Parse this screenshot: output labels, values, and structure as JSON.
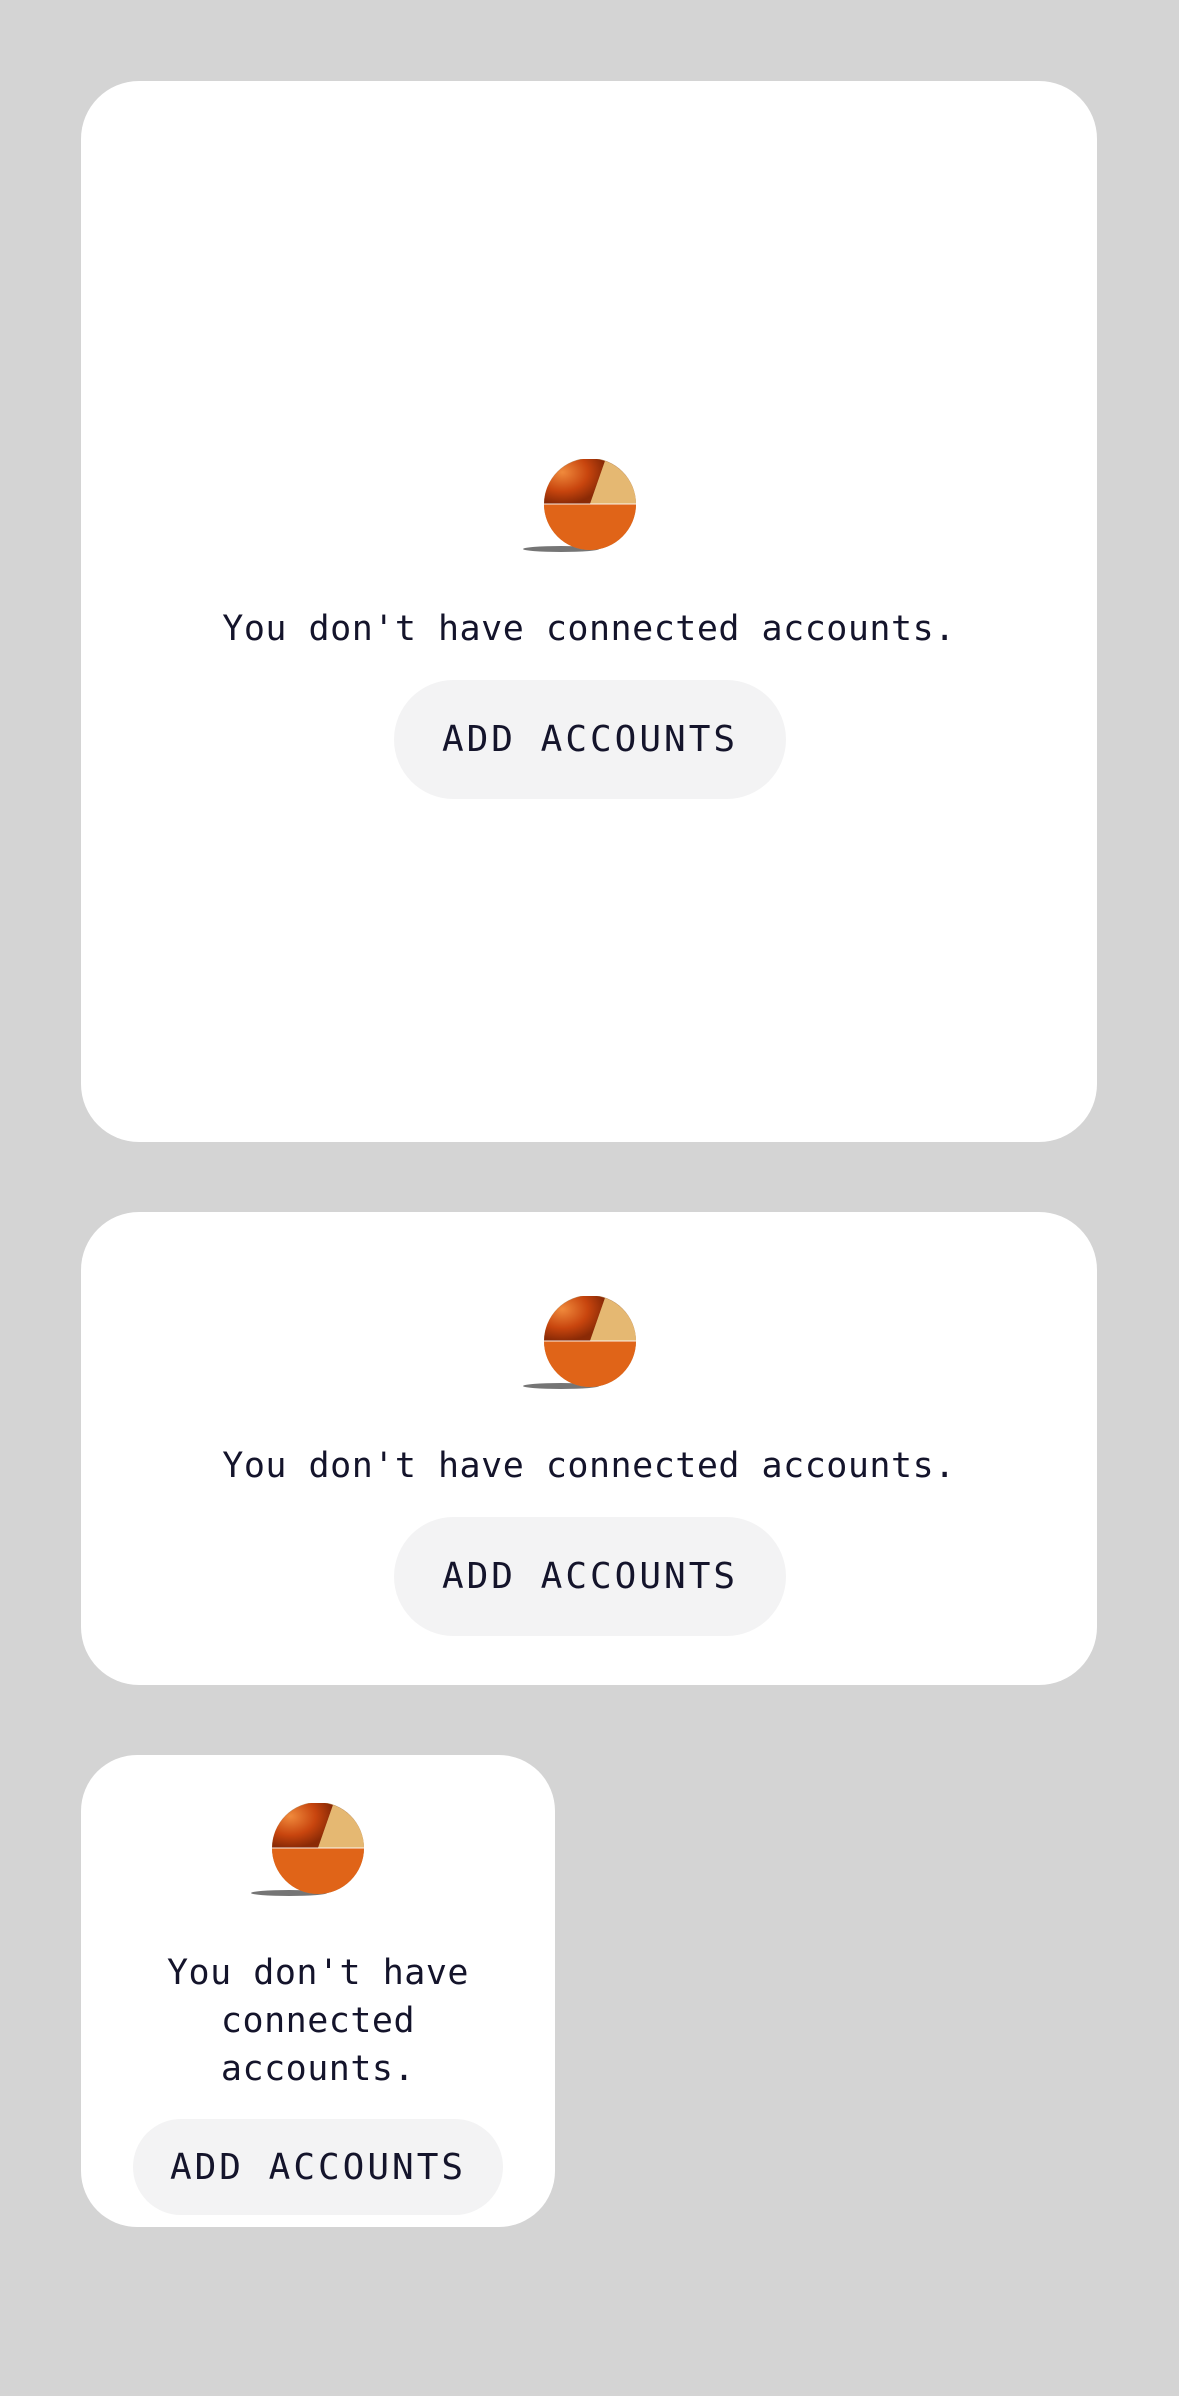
{
  "colors": {
    "background": "#d4d4d4",
    "card": "#ffffff",
    "button": "#f3f3f4",
    "text": "#14142b",
    "icon_primary": "#e06418",
    "icon_light": "#e5b872"
  },
  "cards": [
    {
      "icon": "pie-chart-icon",
      "message": "You don't have connected accounts.",
      "button_label": "ADD ACCOUNTS"
    },
    {
      "icon": "pie-chart-icon",
      "message": "You don't have connected accounts.",
      "button_label": "ADD ACCOUNTS"
    },
    {
      "icon": "pie-chart-icon",
      "message": "You don't have connected accounts.",
      "button_label": "ADD ACCOUNTS"
    }
  ]
}
